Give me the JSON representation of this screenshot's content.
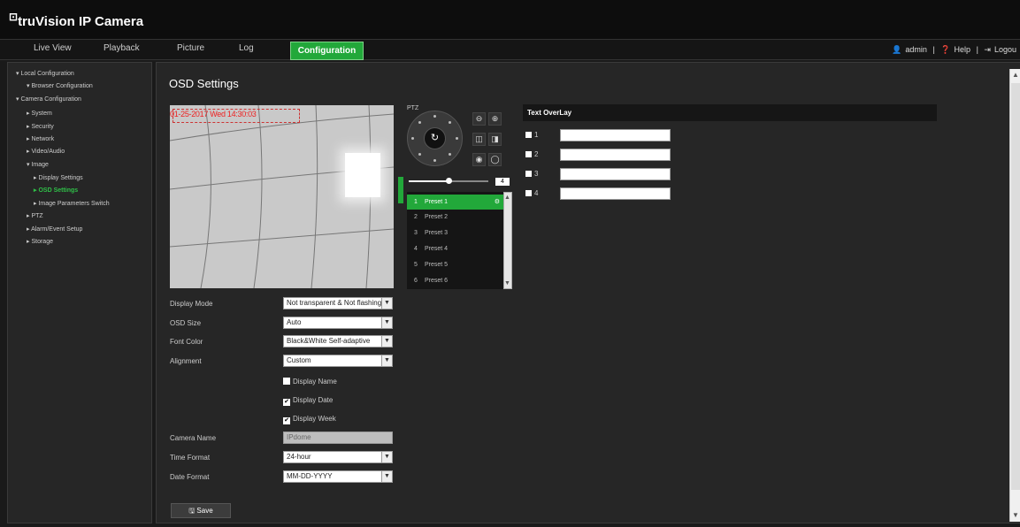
{
  "app": {
    "brand": "truVision IP Camera"
  },
  "nav": {
    "tabs": [
      "Live View",
      "Playback",
      "Picture",
      "Log",
      "Configuration"
    ],
    "active": "Configuration",
    "user": "admin",
    "help": "Help",
    "logout": "Logou"
  },
  "sidebar": {
    "items": [
      "Local Configuration",
      "Browser Configuration",
      "Camera Configuration",
      "System",
      "Security",
      "Network",
      "Video/Audio",
      "Image",
      "Display Settings",
      "OSD Settings",
      "Image Parameters Switch",
      "PTZ",
      "Alarm/Event Setup",
      "Storage"
    ],
    "active": "OSD Settings"
  },
  "page": {
    "title": "OSD Settings"
  },
  "video": {
    "osd_text": "01-25-2017 Wed 14:30:03"
  },
  "form": {
    "display_mode": {
      "label": "Display Mode",
      "value": "Not transparent & Not flashing"
    },
    "osd_size": {
      "label": "OSD Size",
      "value": "Auto"
    },
    "font_color": {
      "label": "Font Color",
      "value": "Black&White Self-adaptive"
    },
    "alignment": {
      "label": "Alignment",
      "value": "Custom"
    },
    "display_name": {
      "label": "Display Name",
      "checked": false
    },
    "display_date": {
      "label": "Display Date",
      "checked": true
    },
    "display_week": {
      "label": "Display Week",
      "checked": true
    },
    "camera_name": {
      "label": "Camera Name",
      "value": "IPdome"
    },
    "time_format": {
      "label": "Time Format",
      "value": "24-hour"
    },
    "date_format": {
      "label": "Date Format",
      "value": "MM-DD-YYYY"
    },
    "save_label": "Save"
  },
  "ptz": {
    "label": "PTZ",
    "speed": "4",
    "speed_fraction": 0.5,
    "presets": [
      {
        "num": "1",
        "name": "Preset 1"
      },
      {
        "num": "2",
        "name": "Preset 2"
      },
      {
        "num": "3",
        "name": "Preset 3"
      },
      {
        "num": "4",
        "name": "Preset 4"
      },
      {
        "num": "5",
        "name": "Preset 5"
      },
      {
        "num": "6",
        "name": "Preset 6"
      }
    ]
  },
  "text_overlay": {
    "title": "Text OverLay",
    "rows": [
      {
        "num": "1",
        "value": ""
      },
      {
        "num": "2",
        "value": ""
      },
      {
        "num": "3",
        "value": ""
      },
      {
        "num": "4",
        "value": ""
      }
    ]
  },
  "colors": {
    "accent": "#22a83a",
    "active_text": "#2fbf48",
    "osd_red": "#e22"
  }
}
